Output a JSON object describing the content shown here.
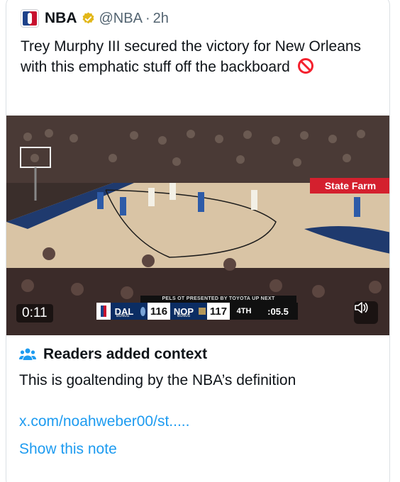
{
  "tweet": {
    "author_name": "NBA",
    "handle": "@NBA",
    "separator": "·",
    "time": "2h",
    "text": "Trey Murphy III secured the victory for New Orleans with this emphatic stuff off the backboard",
    "emoji_icon": "no-entry-icon"
  },
  "video": {
    "elapsed": "0:11",
    "arena_sign": "State Farm",
    "scorebug": {
      "banner": "PELS OT PRESENTED BY TOYOTA UP NEXT",
      "away_team": "DAL",
      "away_score": "116",
      "away_bonus": "BONUS",
      "home_team": "NOP",
      "home_score": "117",
      "home_bonus": "BONUS",
      "period": "4TH",
      "clock": ":05.5"
    }
  },
  "context": {
    "title": "Readers added context",
    "body": "This is goaltending by the NBA’s definition",
    "link": "x.com/noahweber00/st.....",
    "show_note": "Show this note"
  },
  "colors": {
    "link": "#1d9bf0",
    "verified_gold": "#e2b719",
    "secondary_text": "#536471"
  }
}
